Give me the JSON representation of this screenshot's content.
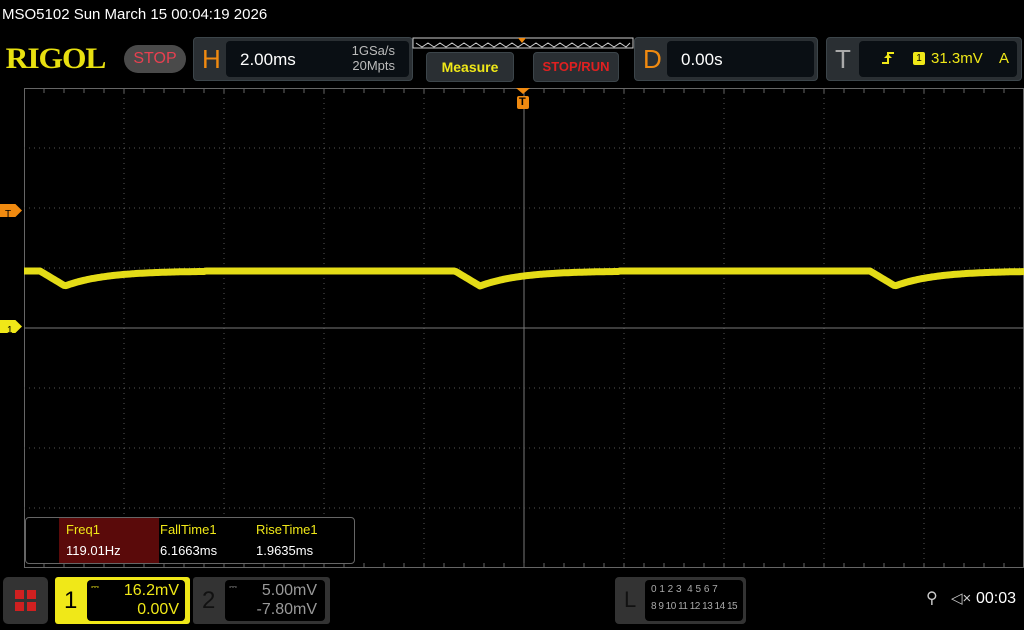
{
  "header": {
    "title": "MSO5102  Sun March 15 00:04:19 2026",
    "logo": "RIGOL",
    "run_state": "STOP"
  },
  "horizontal": {
    "letter": "H",
    "timebase": "2.00ms",
    "sample_rate": "1GSa/s",
    "memory_depth": "20Mpts"
  },
  "buttons": {
    "measure": "Measure",
    "stop_run": "STOP/RUN"
  },
  "delay": {
    "letter": "D",
    "value": "0.00s"
  },
  "trigger": {
    "letter": "T",
    "edge_icon": "rising-edge-icon",
    "source": "1",
    "level": "31.3mV",
    "mode": "A"
  },
  "markers": {
    "trigger_top": "T",
    "trigger_level": "T",
    "channel1": "1"
  },
  "measurements": [
    {
      "label": "Freq1",
      "value": "119.01Hz"
    },
    {
      "label": "FallTime1",
      "value": "6.1663ms"
    },
    {
      "label": "RiseTime1",
      "value": "1.9635ms"
    }
  ],
  "channel1": {
    "number": "1",
    "scale": "16.2mV",
    "offset": "0.00V",
    "color": "#f0e818"
  },
  "channel2": {
    "number": "2",
    "scale": "5.00mV",
    "offset": "-7.80mV"
  },
  "logic": {
    "letter": "L",
    "row1": "0 1 2 3  4 5 6 7",
    "row2": "8 9 10 11 12 13 14 15"
  },
  "status": {
    "usb_icon": "usb-icon",
    "mute_icon": "speaker-muted-icon",
    "clock": "00:03"
  }
}
